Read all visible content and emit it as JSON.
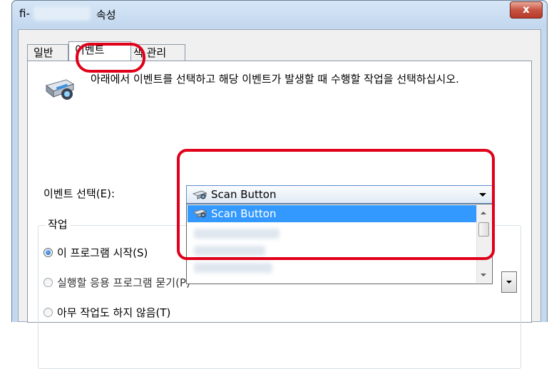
{
  "window": {
    "title_prefix": "fi-",
    "title_suffix": "속성",
    "close_glyph": "x"
  },
  "tabs": [
    {
      "label": "일반",
      "active": false
    },
    {
      "label": "이벤트",
      "active": true
    },
    {
      "label": "색 관리",
      "active": false
    }
  ],
  "description": "아래에서 이벤트를 선택하고 해당 이벤트가 발생할 때 수행할 작업을 선택하십시오.",
  "event_select": {
    "label": "이벤트 선택(E):",
    "value": "Scan Button",
    "options": [
      "Scan Button"
    ]
  },
  "actions": {
    "group_label": "작업",
    "options": [
      {
        "label": "이 프로그램 시작(S)",
        "checked": true
      },
      {
        "label": "실행할 응용 프로그램 묻기(P)",
        "checked": false
      },
      {
        "label": "아무 작업도 하지 않음(T)",
        "checked": false
      }
    ]
  },
  "icons": {
    "scanner": "scanner-icon",
    "close": "close-icon",
    "dropdown": "chevron-down-icon"
  },
  "colors": {
    "highlight_red": "#e0001a",
    "selection_blue": "#3399ff",
    "window_frame": "#c4d8ee"
  }
}
